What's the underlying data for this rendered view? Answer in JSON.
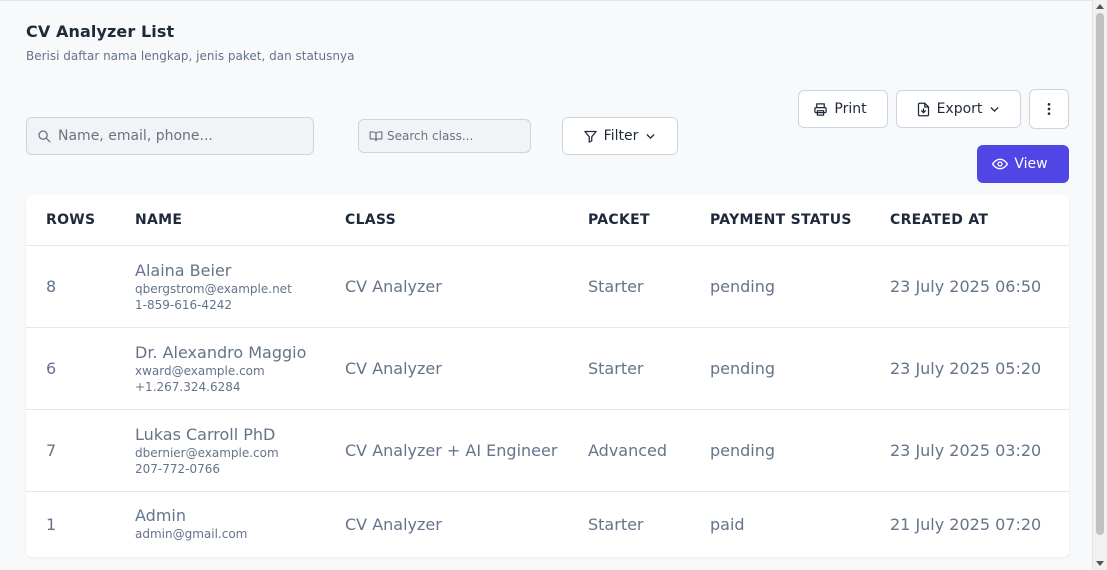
{
  "page": {
    "title": "CV Analyzer List",
    "subtitle": "Berisi daftar nama lengkap, jenis paket, dan statusnya"
  },
  "search": {
    "placeholder": "Name, email, phone..."
  },
  "class_search": {
    "placeholder": "Search class..."
  },
  "toolbar": {
    "filter_label": "Filter",
    "print_label": "Print",
    "export_label": "Export",
    "view_label": "View"
  },
  "icons": {
    "search": "search-icon",
    "book": "book-icon",
    "filter": "filter-icon",
    "print": "printer-icon",
    "export": "file-export-icon",
    "chevron": "chevron-down-icon",
    "more": "more-vertical-icon",
    "view": "eye-icon"
  },
  "colors": {
    "accent": "#4f46e5"
  },
  "table": {
    "headers": [
      "ROWS",
      "NAME",
      "CLASS",
      "PACKET",
      "PAYMENT STATUS",
      "CREATED AT"
    ],
    "rows": [
      {
        "rows": "8",
        "name": "Alaina Beier",
        "email": "qbergstrom@example.net",
        "phone": "1-859-616-4242",
        "class": "CV Analyzer",
        "packet": "Starter",
        "payment_status": "pending",
        "created_at": "23 July 2025 06:50"
      },
      {
        "rows": "6",
        "name": "Dr. Alexandro Maggio",
        "email": "xward@example.com",
        "phone": "+1.267.324.6284",
        "class": "CV Analyzer",
        "packet": "Starter",
        "payment_status": "pending",
        "created_at": "23 July 2025 05:20"
      },
      {
        "rows": "7",
        "name": "Lukas Carroll PhD",
        "email": "dbernier@example.com",
        "phone": "207-772-0766",
        "class": "CV Analyzer + AI Engineer",
        "packet": "Advanced",
        "payment_status": "pending",
        "created_at": "23 July 2025 03:20"
      },
      {
        "rows": "1",
        "name": "Admin",
        "email": "admin@gmail.com",
        "class": "CV Analyzer",
        "packet": "Starter",
        "payment_status": "paid",
        "created_at": "21 July 2025 07:20"
      }
    ]
  }
}
